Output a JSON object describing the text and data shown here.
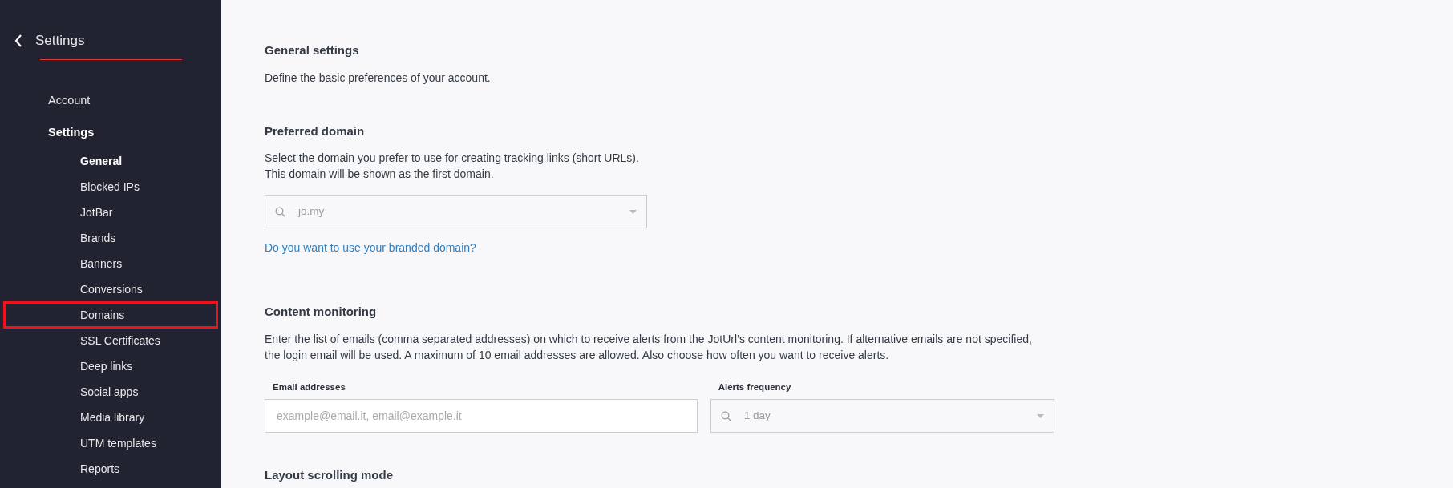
{
  "sidebar": {
    "title": "Settings",
    "items": [
      {
        "label": "Account",
        "selected": false
      },
      {
        "label": "Settings",
        "selected": true,
        "children": [
          {
            "label": "General",
            "selected": true,
            "highlighted": false
          },
          {
            "label": "Blocked IPs",
            "selected": false,
            "highlighted": false
          },
          {
            "label": "JotBar",
            "selected": false,
            "highlighted": false
          },
          {
            "label": "Brands",
            "selected": false,
            "highlighted": false
          },
          {
            "label": "Banners",
            "selected": false,
            "highlighted": false
          },
          {
            "label": "Conversions",
            "selected": false,
            "highlighted": false
          },
          {
            "label": "Domains",
            "selected": false,
            "highlighted": true
          },
          {
            "label": "SSL Certificates",
            "selected": false,
            "highlighted": false
          },
          {
            "label": "Deep links",
            "selected": false,
            "highlighted": false
          },
          {
            "label": "Social apps",
            "selected": false,
            "highlighted": false
          },
          {
            "label": "Media library",
            "selected": false,
            "highlighted": false
          },
          {
            "label": "UTM templates",
            "selected": false,
            "highlighted": false
          },
          {
            "label": "Reports",
            "selected": false,
            "highlighted": false
          }
        ]
      }
    ]
  },
  "sections": [
    {
      "heading": "General settings",
      "description": [
        "Define the basic preferences of your account."
      ]
    },
    {
      "heading": "Preferred domain",
      "description": [
        "Select the domain you prefer to use for creating tracking links (short URLs).",
        "This domain will be shown as the first domain."
      ],
      "select": {
        "value": "jo.my"
      },
      "link": "Do you want to use your branded domain?"
    },
    {
      "heading": "Content monitoring",
      "description": [
        "Enter the list of emails (comma separated addresses) on which to receive alerts from the JotUrl’s content monitoring. If alternative emails are not specified,",
        "the login email will be used. A maximum of 10 email addresses are allowed. Also choose how often you want to receive alerts."
      ],
      "fields": [
        {
          "kind": "input",
          "label": "Email addresses",
          "placeholder": "example@email.it, email@example.it"
        },
        {
          "kind": "select",
          "label": "Alerts frequency",
          "value": "1 day"
        }
      ]
    },
    {
      "heading": "Layout scrolling mode"
    }
  ]
}
